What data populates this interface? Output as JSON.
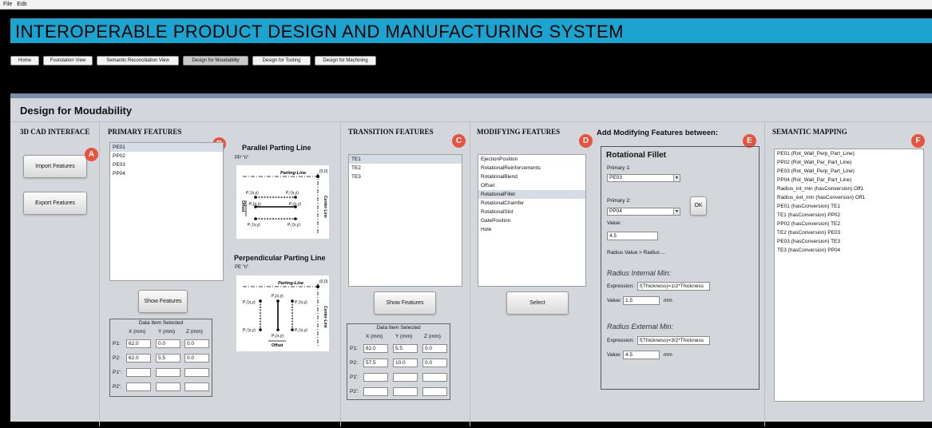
{
  "menu": [
    "File",
    "Edit"
  ],
  "app_title": "INTEROPERABLE PRODUCT DESIGN AND MANUFACTURING SYSTEM",
  "tabs": [
    "Home",
    "Foundation View",
    "Semantic Reconciliation View",
    "Design for Moudability",
    "Design for Tooling",
    "Design for Machining"
  ],
  "active_tab": "Design for Moudability",
  "page_title": "Design for Moudability",
  "cad": {
    "heading": "3D CAD INTERFACE",
    "import_label": "Import Features",
    "export_label": "Export Features",
    "badge": "A"
  },
  "primary": {
    "heading": "PRIMARY FEATURES",
    "badge": "B",
    "items": [
      "PE01",
      "PP02",
      "PE03",
      "PP04"
    ],
    "selected": "PE01",
    "parallel_title": "Parallel Parting Line",
    "parallel_sub": "PP \"n\"",
    "perp_title": "Perpendicular Parting Line",
    "perp_sub": "PE \"n\"",
    "diagram": {
      "parting_line": "Parting-Line",
      "center_line": "Center-Line",
      "origin": "(0,0)",
      "offset": "Offset",
      "p1": "P₁(x,y)",
      "p2": "P₂(x,y)",
      "p1p": "P₁'(x,y)",
      "p2p": "P₂'(x,y)"
    },
    "show_label": "Show Features",
    "data": {
      "title": "Data Item Selected",
      "cols": [
        "X (mm)",
        "Y (mm)",
        "Z (mm)"
      ],
      "rows": [
        {
          "label": "P1:",
          "values": [
            "62.0",
            "0.0",
            "0.0"
          ]
        },
        {
          "label": "P2:",
          "values": [
            "62.0",
            "5.5",
            "0.0"
          ]
        },
        {
          "label": "P1':",
          "values": [
            "",
            "",
            ""
          ]
        },
        {
          "label": "P2':",
          "values": [
            "",
            "",
            ""
          ]
        }
      ]
    }
  },
  "transition": {
    "heading": "TRANSITION FEATURES",
    "badge": "C",
    "items": [
      "TE1",
      "TE2",
      "TE3"
    ],
    "selected": "TE1",
    "show_label": "Show Features",
    "data": {
      "title": "Data Item Selected",
      "cols": [
        "X (mm)",
        "Y (mm)",
        "Z (mm)"
      ],
      "rows": [
        {
          "label": "P1:",
          "values": [
            "62.0",
            "5.5",
            "0.0"
          ]
        },
        {
          "label": "P2:",
          "values": [
            "57.5",
            "10.0",
            "0.0"
          ]
        },
        {
          "label": "P1':",
          "values": [
            "",
            "",
            ""
          ]
        },
        {
          "label": "P2':",
          "values": [
            "",
            "",
            ""
          ]
        }
      ]
    }
  },
  "modifying": {
    "heading": "MODIFYING FEATURES",
    "badge": "D",
    "items": [
      "EjectionPosition",
      "RotationalReinforcements",
      "RotationalBlend",
      "Offset",
      "RotationalFillet",
      "RotationalChamfer",
      "RotationalSlot",
      "GatePosition",
      "Hole"
    ],
    "selected": "RotationalFillet",
    "select_label": "Select"
  },
  "add_mod": {
    "heading": "Add Modifying Features between:",
    "badge": "E",
    "panel_title": "Rotational Fillet",
    "primary1_label": "Primary 1:",
    "primary1_value": "PE03",
    "primary2_label": "Primary 2:",
    "primary2_value": "PP04",
    "ok_label": "OK",
    "value_label": "Value:",
    "value": "4.5",
    "rule": "Radius Value > Radius ...",
    "int_title": "Radius Internal Min:",
    "int_expr_label": "Expression:",
    "int_expr": "f(Thickness)=1/2*Thickness",
    "int_value_label": "Value:",
    "int_value": "1.5",
    "int_unit": "mm",
    "ext_title": "Radius External Min:",
    "ext_expr_label": "Expression:",
    "ext_expr": "f(Thickness)=3/2*Thickness",
    "ext_value_label": "Value:",
    "ext_value": "4.5",
    "ext_unit": "mm"
  },
  "semantic": {
    "heading": "SEMANTIC MAPPING",
    "badge": "F",
    "items": [
      "PE01 (Rot_Wall_Perp_Part_Line)",
      "PP02 (Rot_Wall_Par_Part_Line)",
      "PE03 (Rot_Wall_Perp_Part_Line)",
      "PP04 (Rot_Wall_Par_Part_Line)",
      "Radius_int_min (hasConversion) Off1",
      "Radius_ext_min (hasConversion) Off1",
      "PE01 (hasConversion) TE1",
      "TE1 (hasConversion) PP02",
      "PP02 (hasConversion) TE2",
      "TE2 (hasConversion) PE03",
      "PE03 (hasConversion) TE3",
      "TE3 (hasConversion) PP04"
    ]
  },
  "colors": {
    "banner": "#1aa4cf",
    "badge": "#e8533f",
    "panel": "#d3d7dc",
    "accent_bar": "#7a8ea5"
  }
}
